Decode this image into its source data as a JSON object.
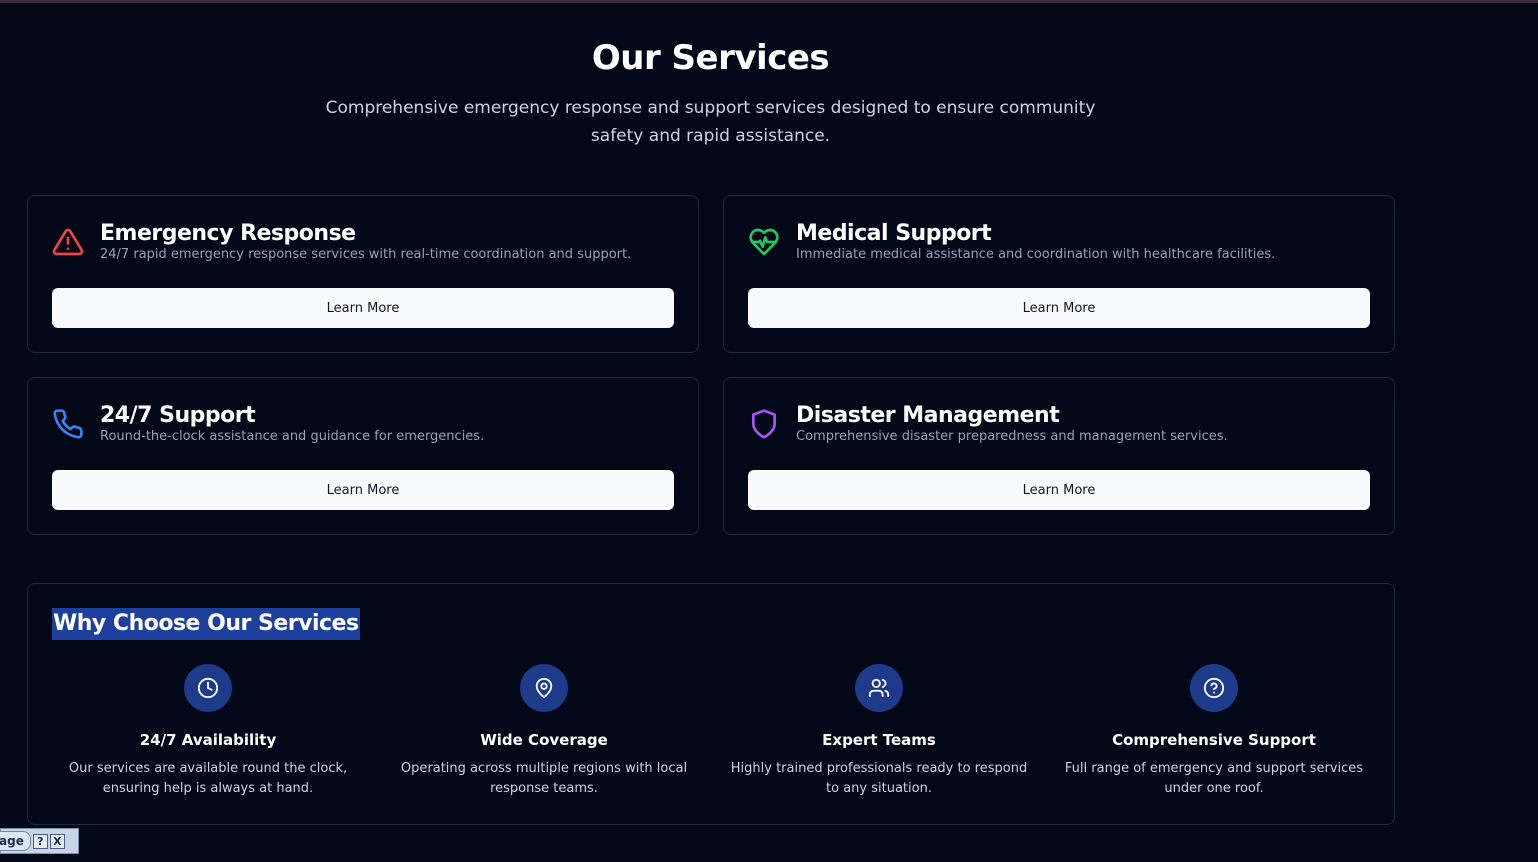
{
  "header": {
    "title": "Our Services",
    "subtitle": "Comprehensive emergency response and support services designed to ensure community safety and rapid assistance."
  },
  "services": [
    {
      "title": "Emergency Response",
      "description": "24/7 rapid emergency response services with real-time coordination and support.",
      "button": "Learn More",
      "icon": "alert-triangle-icon",
      "color": "#ef4444"
    },
    {
      "title": "Medical Support",
      "description": "Immediate medical assistance and coordination with healthcare facilities.",
      "button": "Learn More",
      "icon": "heart-pulse-icon",
      "color": "#22c55e"
    },
    {
      "title": "24/7 Support",
      "description": "Round-the-clock assistance and guidance for emergencies.",
      "button": "Learn More",
      "icon": "phone-icon",
      "color": "#3b82f6"
    },
    {
      "title": "Disaster Management",
      "description": "Comprehensive disaster preparedness and management services.",
      "button": "Learn More",
      "icon": "shield-icon",
      "color": "#a855f7"
    }
  ],
  "why": {
    "title": "Why Choose Our Services",
    "features": [
      {
        "title": "24/7 Availability",
        "description": "Our services are available round the clock, ensuring help is always at hand.",
        "icon": "clock-icon"
      },
      {
        "title": "Wide Coverage",
        "description": "Operating across multiple regions with local response teams.",
        "icon": "map-pin-icon"
      },
      {
        "title": "Expert Teams",
        "description": "Highly trained professionals ready to respond to any situation.",
        "icon": "users-icon"
      },
      {
        "title": "Comprehensive Support",
        "description": "Full range of emergency and support services under one roof.",
        "icon": "help-circle-icon"
      }
    ]
  },
  "taskbar": {
    "label": "age",
    "help": "?",
    "close": "X"
  }
}
